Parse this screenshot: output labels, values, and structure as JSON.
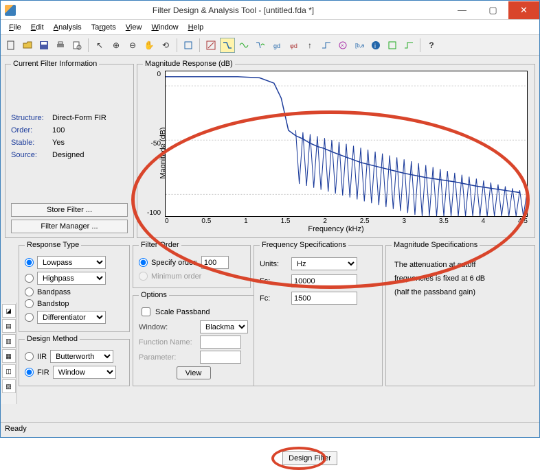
{
  "title": "Filter Design & Analysis Tool -   [untitled.fda *]",
  "menu": [
    "File",
    "Edit",
    "Analysis",
    "Targets",
    "View",
    "Window",
    "Help"
  ],
  "filter_info": {
    "legend": "Current Filter Information",
    "rows": [
      {
        "label": "Structure:",
        "value": "Direct-Form FIR"
      },
      {
        "label": "Order:",
        "value": "100"
      },
      {
        "label": "Stable:",
        "value": "Yes"
      },
      {
        "label": "Source:",
        "value": "Designed"
      }
    ],
    "store_btn": "Store Filter ...",
    "mgr_btn": "Filter Manager ..."
  },
  "plot": {
    "legend": "Magnitude Response (dB)",
    "ylabel": "Magnitude (dB)",
    "xlabel": "Frequency (kHz)",
    "yticks": [
      "0",
      "-50",
      "-100"
    ],
    "xticks": [
      "0",
      "0.5",
      "1",
      "1.5",
      "2",
      "2.5",
      "3",
      "3.5",
      "4",
      "4.5"
    ]
  },
  "response_type": {
    "legend": "Response Type",
    "rows": [
      {
        "label": "Lowpass",
        "select": true,
        "checked": true
      },
      {
        "label": "Highpass",
        "select": true,
        "checked": false
      },
      {
        "label": "Bandpass",
        "select": false,
        "checked": false
      },
      {
        "label": "Bandstop",
        "select": false,
        "checked": false
      },
      {
        "label": "Differentiator",
        "select": true,
        "checked": false
      }
    ]
  },
  "design_method": {
    "legend": "Design Method",
    "iir_label": "IIR",
    "iir_value": "Butterworth",
    "fir_label": "FIR",
    "fir_value": "Window"
  },
  "filter_order": {
    "legend": "Filter Order",
    "specify": "Specify order:",
    "specify_val": "100",
    "minimum": "Minimum order"
  },
  "options": {
    "legend": "Options",
    "scale": "Scale Passband",
    "window": "Window:",
    "window_val": "Blackman",
    "fn": "Function Name:",
    "param": "Parameter:",
    "view": "View"
  },
  "freq": {
    "legend": "Frequency Specifications",
    "units": "Units:",
    "units_val": "Hz",
    "fs": "Fs:",
    "fs_val": "10000",
    "fc": "Fc:",
    "fc_val": "1500"
  },
  "mag": {
    "legend": "Magnitude Specifications",
    "text1": "The attenuation at cutoff",
    "text2": "frequencies is fixed at 6 dB",
    "text3": "(half the passband gain)"
  },
  "design_btn": "Design Filter",
  "status": "Ready",
  "chart_data": {
    "type": "line",
    "title": "Magnitude Response (dB)",
    "xlabel": "Frequency (kHz)",
    "ylabel": "Magnitude (dB)",
    "xlim": [
      0,
      5
    ],
    "ylim": [
      -130,
      5
    ],
    "x": [
      0,
      0.2,
      0.5,
      1.0,
      1.3,
      1.5,
      1.6,
      1.7,
      1.8,
      1.9,
      2.0,
      2.1,
      2.2,
      2.3,
      2.5,
      2.7,
      3.0,
      3.3,
      3.6,
      4.0,
      4.3,
      4.6,
      4.9
    ],
    "y": [
      0,
      0,
      0,
      0,
      -1,
      -6,
      -20,
      -50,
      -55,
      -58,
      -62,
      -65,
      -67,
      -70,
      -75,
      -80,
      -85,
      -90,
      -94,
      -98,
      -102,
      -105,
      -108
    ],
    "series": [
      {
        "name": "Magnitude",
        "color": "#1a3a9a"
      }
    ]
  }
}
